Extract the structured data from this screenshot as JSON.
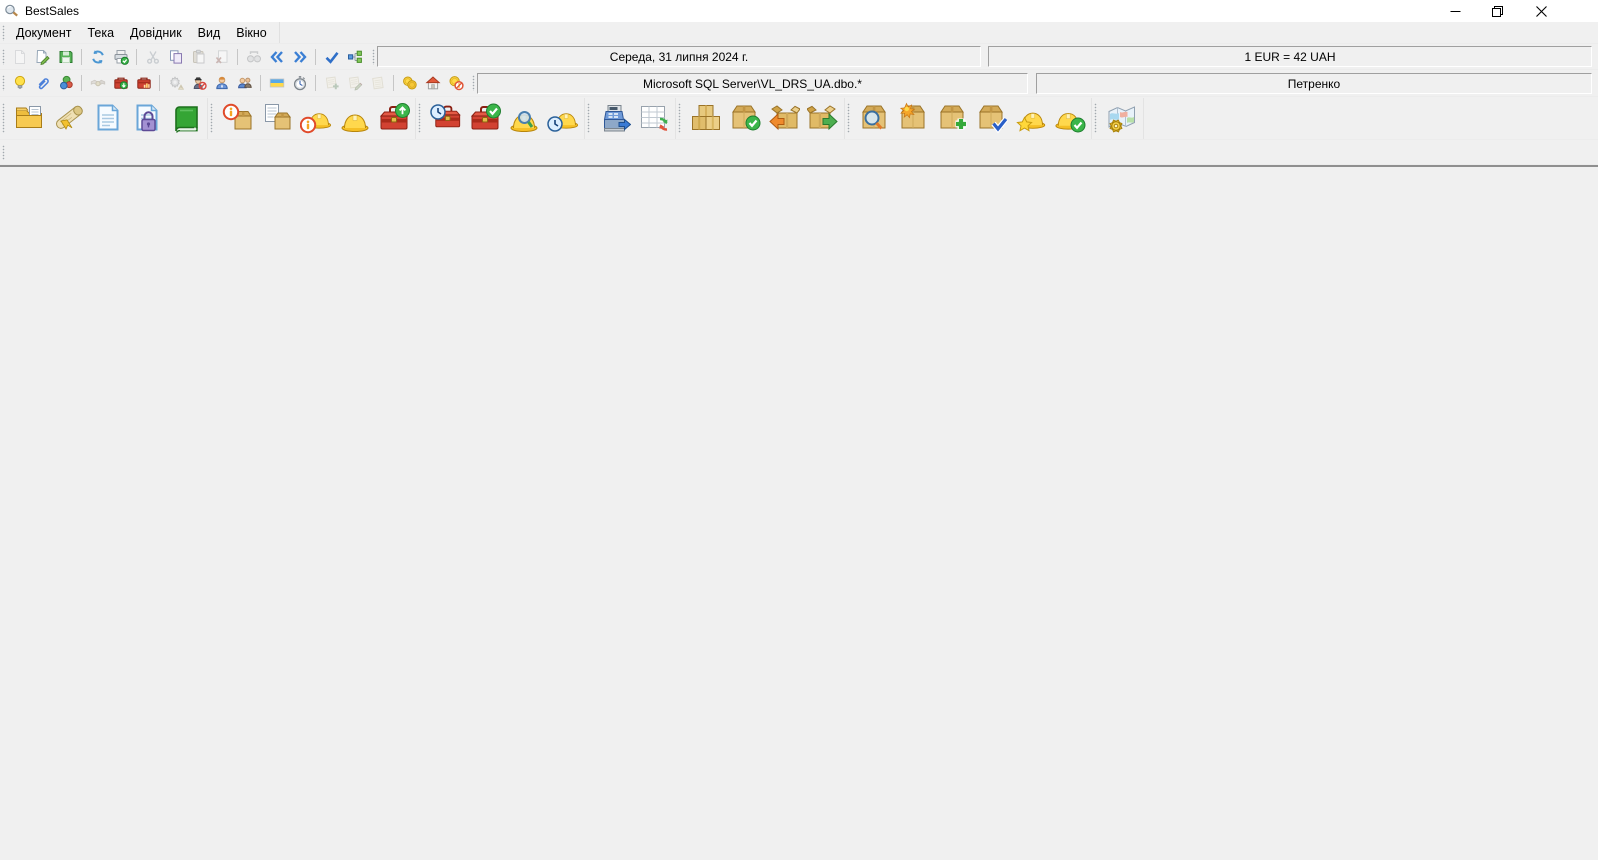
{
  "window": {
    "title": "BestSales",
    "controls": [
      {
        "icon": "minimize"
      },
      {
        "icon": "restore"
      },
      {
        "icon": "close"
      }
    ]
  },
  "menu": {
    "items": [
      {
        "label": "Документ"
      },
      {
        "label": "Тека"
      },
      {
        "label": "Довідник"
      },
      {
        "label": "Вид"
      },
      {
        "label": "Вікно"
      }
    ]
  },
  "status_panels": {
    "date": "Середа, 31 липня 2024 г.",
    "exchange_rate": "1 EUR = 42 UAH",
    "database": "Microsoft SQL Server\\VL_DRS_UA.dbo.*",
    "user": "Петренко"
  },
  "toolbars": {
    "row1_groups": [
      {
        "buttons": [
          {
            "icon": "new-document",
            "disabled": true
          },
          {
            "icon": "edit-document"
          },
          {
            "icon": "save"
          }
        ]
      },
      {
        "buttons": [
          {
            "icon": "refresh"
          },
          {
            "icon": "print-verified"
          }
        ]
      },
      {
        "buttons": [
          {
            "icon": "cut",
            "disabled": true
          },
          {
            "icon": "copy"
          },
          {
            "icon": "paste",
            "disabled": true
          },
          {
            "icon": "delete",
            "disabled": true
          }
        ]
      },
      {
        "buttons": [
          {
            "icon": "binoculars",
            "disabled": true
          },
          {
            "icon": "nav-previous"
          },
          {
            "icon": "nav-next"
          }
        ]
      },
      {
        "buttons": [
          {
            "icon": "apply-check"
          },
          {
            "icon": "tree-structure"
          }
        ]
      }
    ],
    "row2_groups": [
      {
        "buttons": [
          {
            "icon": "light-bulb"
          },
          {
            "icon": "paperclip"
          },
          {
            "icon": "color-spheres"
          }
        ]
      },
      {
        "buttons": [
          {
            "icon": "handshake",
            "disabled": true
          },
          {
            "icon": "cashbox-in"
          },
          {
            "icon": "cashbox-report"
          }
        ]
      },
      {
        "buttons": [
          {
            "icon": "gear-warning",
            "disabled": true
          },
          {
            "icon": "user-blocked"
          },
          {
            "icon": "user-manager"
          },
          {
            "icon": "user-group"
          }
        ]
      },
      {
        "buttons": [
          {
            "icon": "flag-ukraine"
          },
          {
            "icon": "stopwatch"
          }
        ]
      },
      {
        "buttons": [
          {
            "icon": "note-add",
            "disabled": true
          },
          {
            "icon": "note-edit",
            "disabled": true
          },
          {
            "icon": "notes",
            "disabled": true
          }
        ]
      },
      {
        "buttons": [
          {
            "icon": "coins"
          },
          {
            "icon": "home-warehouse"
          },
          {
            "icon": "coin-blocked"
          }
        ]
      }
    ],
    "row3_chunks": [
      {
        "buttons": [
          {
            "icon": "folder-document"
          },
          {
            "icon": "certificate"
          },
          {
            "icon": "invoice"
          },
          {
            "icon": "invoice-lock"
          },
          {
            "icon": "green-book"
          }
        ]
      },
      {
        "buttons": [
          {
            "icon": "box-info"
          },
          {
            "icon": "document-box"
          },
          {
            "icon": "info-hardhat"
          },
          {
            "icon": "hardhat"
          },
          {
            "icon": "toolbox-up"
          }
        ]
      },
      {
        "buttons": [
          {
            "icon": "toolbox-clock"
          },
          {
            "icon": "toolbox-check"
          },
          {
            "icon": "hardhat-search"
          },
          {
            "icon": "hardhat-clock"
          }
        ]
      },
      {
        "buttons": [
          {
            "icon": "cash-register"
          },
          {
            "icon": "table-refresh"
          }
        ]
      },
      {
        "buttons": [
          {
            "icon": "boxes"
          },
          {
            "icon": "box-check"
          },
          {
            "icon": "box-receive"
          },
          {
            "icon": "box-dispatch"
          }
        ]
      },
      {
        "buttons": [
          {
            "icon": "box-search"
          },
          {
            "icon": "box-new"
          },
          {
            "icon": "box-add"
          },
          {
            "icon": "box-verify"
          },
          {
            "icon": "hardhat-star"
          },
          {
            "icon": "hardhat-check"
          }
        ]
      },
      {
        "buttons": [
          {
            "icon": "map-settings"
          }
        ]
      }
    ]
  }
}
